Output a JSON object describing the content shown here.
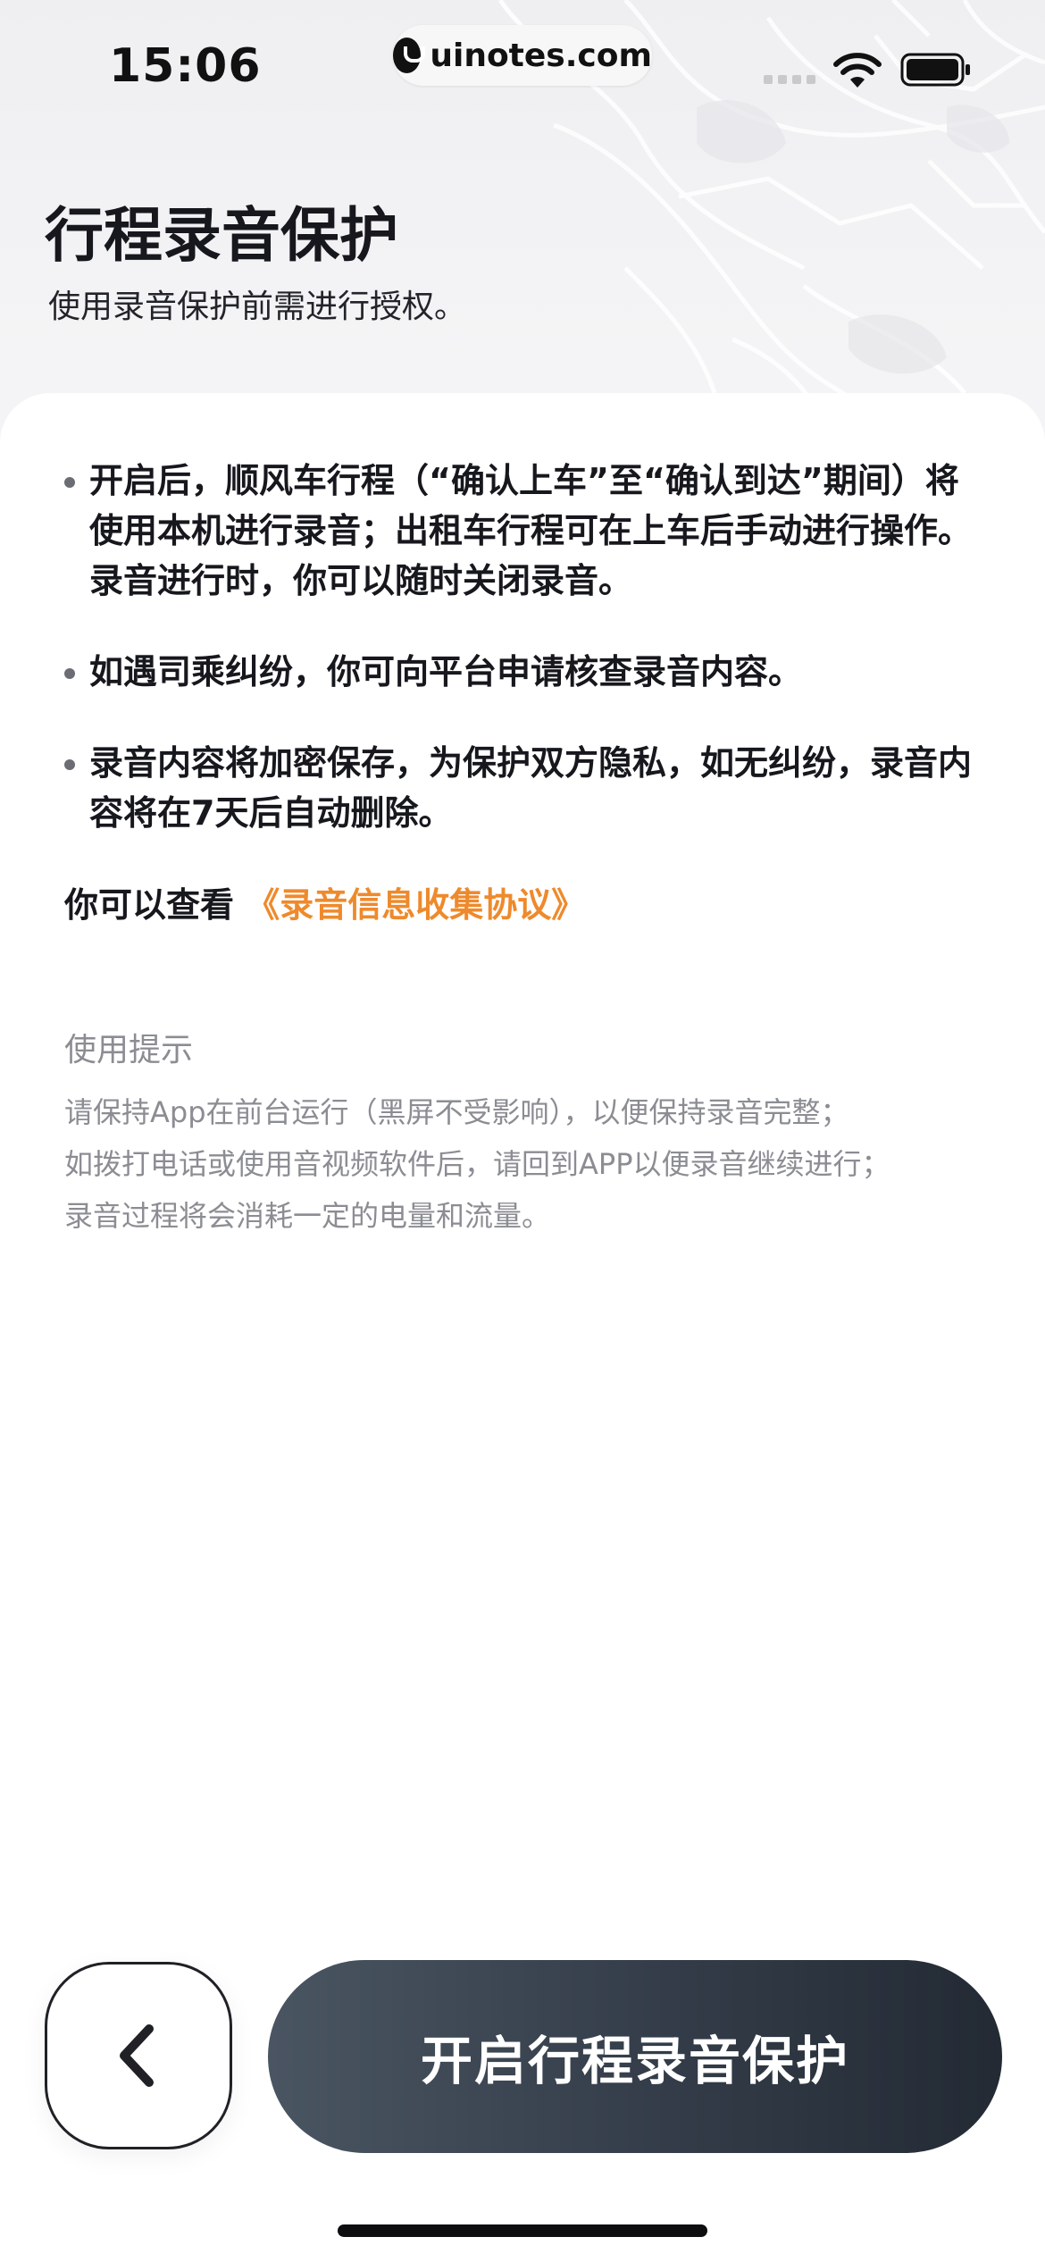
{
  "status_bar": {
    "time": "15:06",
    "url": "uinotes.com"
  },
  "header": {
    "title": "行程录音保护",
    "subtitle": "使用录音保护前需进行授权。"
  },
  "bullets": [
    "开启后，顺风车行程（“确认上车”至“确认到达”期间）将使用本机进行录音；出租车行程可在上车后手动进行操作。录音进行时，你可以随时关闭录音。",
    "如遇司乘纠纷，你可向平台申请核查录音内容。",
    "录音内容将加密保存，为保护双方隐私，如无纠纷，录音内容将在7天后自动删除。"
  ],
  "agreement": {
    "prefix": "你可以查看",
    "link": "《录音信息收集协议》"
  },
  "tips": {
    "title": "使用提示",
    "lines": [
      "请保持App在前台运行（黑屏不受影响），以便保持录音完整；",
      "如拨打电话或使用音视频软件后，请回到APP以便录音继续进行；",
      "录音过程将会消耗一定的电量和流量。"
    ]
  },
  "actions": {
    "primary_label": "开启行程录音保护",
    "back_icon": "chevron-left-icon"
  },
  "colors": {
    "link": "#ee8a2c",
    "primary_button": "#333c48",
    "tips_text": "#8b8d93"
  }
}
